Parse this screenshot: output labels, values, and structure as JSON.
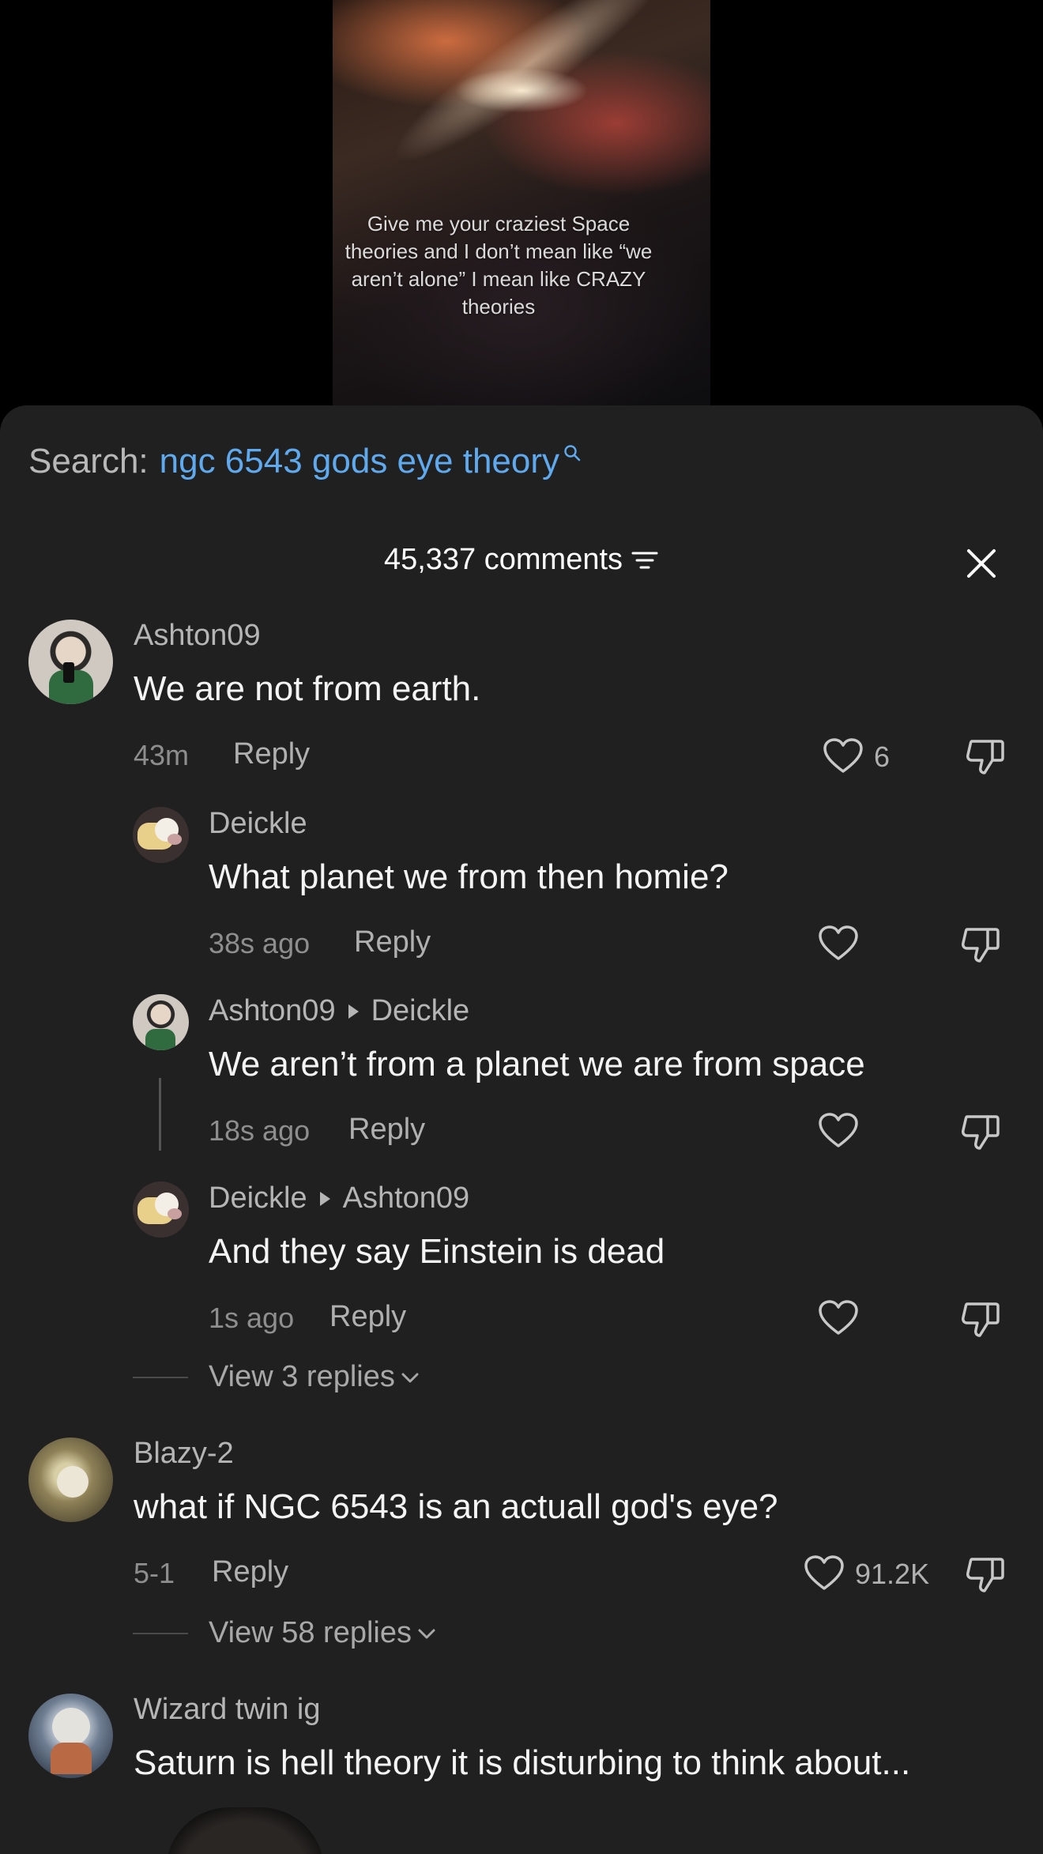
{
  "video": {
    "caption": "Give me your craziest Space theories and I don’t mean like “we aren’t alone” I mean like CRAZY theories"
  },
  "search": {
    "label": "Search:",
    "term": "ngc 6543 gods eye theory"
  },
  "header": {
    "comment_count": "45,337 comments"
  },
  "comments": [
    {
      "username": "Ashton09",
      "text": "We are not from earth.",
      "time": "43m",
      "reply_label": "Reply",
      "likes": "6"
    },
    {
      "username": "Deickle",
      "text": "What planet we from then homie?",
      "time": "38s ago",
      "reply_label": "Reply"
    },
    {
      "username": "Ashton09",
      "reply_to": "Deickle",
      "text": "We aren’t from a planet we are from space",
      "time": "18s ago",
      "reply_label": "Reply"
    },
    {
      "username": "Deickle",
      "reply_to": "Ashton09",
      "text": "And they say Einstein is dead",
      "time": "1s ago",
      "reply_label": "Reply"
    },
    {
      "view_replies": "View 3 replies"
    },
    {
      "username": "Blazy-2",
      "text": "what if NGC 6543 is an actuall god's eye?",
      "time": "5-1",
      "reply_label": "Reply",
      "likes": "91.2K",
      "view_replies": "View 58 replies"
    },
    {
      "username": "Wizard twin ig",
      "text": "Saturn is hell theory it is disturbing to think about..."
    }
  ],
  "colors": {
    "sheet_bg": "#202020",
    "search_term": "#5fa9ee",
    "text_primary": "#f4f4f4",
    "text_secondary": "#b5b5b5"
  }
}
